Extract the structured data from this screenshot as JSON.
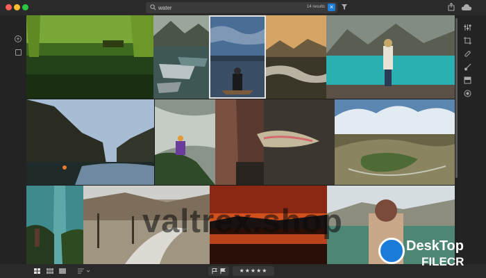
{
  "search": {
    "value": "water",
    "placeholder": "Search",
    "result_count": "14 results"
  },
  "bottom": {
    "stars": "★★★★★"
  },
  "watermark": {
    "text": "valtrex.shop"
  },
  "badge": {
    "title": "DeskTop",
    "subtitle": "FILECR"
  },
  "photos": [
    {
      "name": "willow-lake",
      "top": "#6a9a2c",
      "bottom": "#1c3410"
    },
    {
      "name": "canoes-mountain-lake",
      "top": "#8a9588",
      "bottom": "#3b4b48"
    },
    {
      "name": "kayaker-blue-sky",
      "top": "#3a5c86",
      "bottom": "#1b2a3a"
    },
    {
      "name": "sunset-river-bend",
      "top": "#c79a5c",
      "bottom": "#2d2b26"
    },
    {
      "name": "woman-glacial-lake",
      "top": "#7e8a84",
      "bottom": "#2aa3a6"
    },
    {
      "name": "river-canyon-dusk",
      "top": "#9fb6cf",
      "bottom": "#1e2627"
    },
    {
      "name": "rapids-hiker",
      "top": "#9aa39b",
      "bottom": "#2d4428"
    },
    {
      "name": "fisherman-trout",
      "top": "#6b4b3a",
      "bottom": "#2d2b28"
    },
    {
      "name": "aerial-valley-clouds",
      "top": "#c9d8e6",
      "bottom": "#6e6a46"
    },
    {
      "name": "waterfall-tropical",
      "top": "#3f8d8f",
      "bottom": "#233521"
    },
    {
      "name": "dry-creek-canyon",
      "top": "#a89b88",
      "bottom": "#4f4a3f"
    },
    {
      "name": "red-lake-sunset",
      "top": "#b23b1e",
      "bottom": "#1a0c08"
    },
    {
      "name": "woman-lake-overlook",
      "top": "#c8d3d8",
      "bottom": "#4b7d6e"
    }
  ]
}
